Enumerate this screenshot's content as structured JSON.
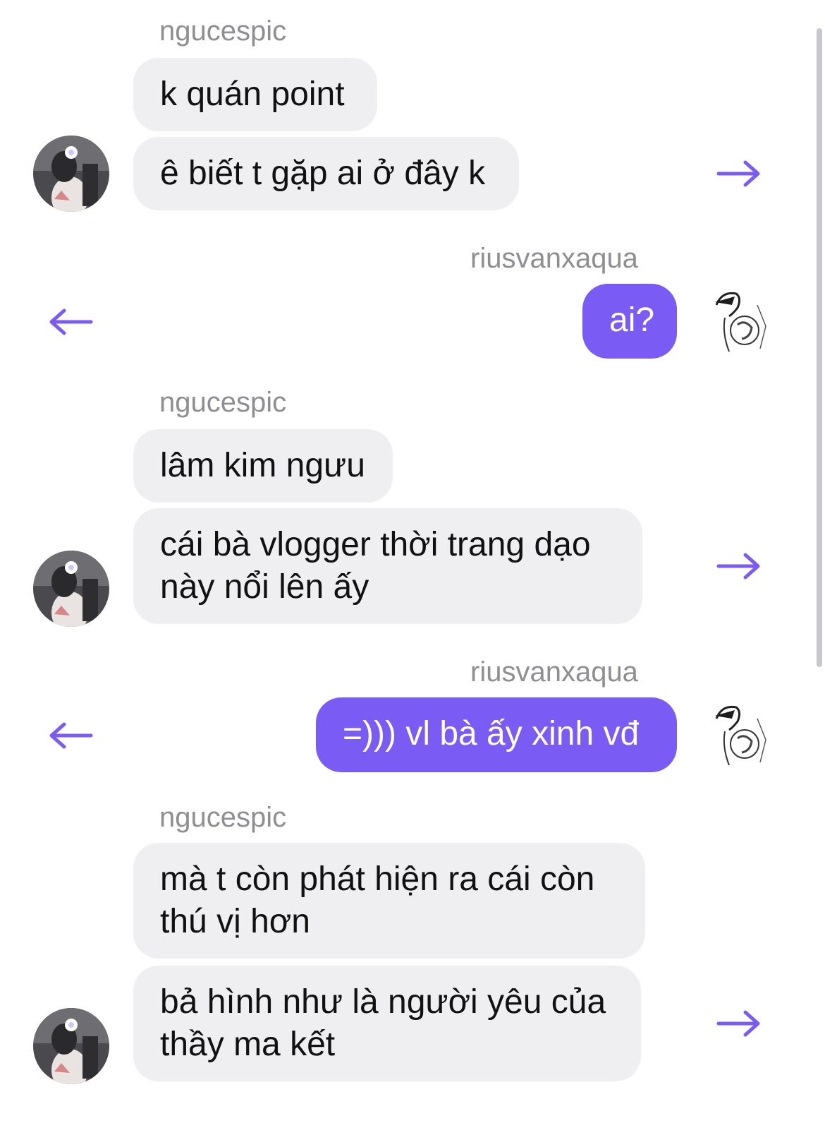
{
  "colors": {
    "accent": "#7a5cf5",
    "incoming_bubble": "#efeff1",
    "username": "#8e8e93"
  },
  "icons": {
    "forward": "arrow-right-icon",
    "reply": "arrow-left-icon"
  },
  "messages": [
    {
      "sender": "ngucespic",
      "text": "k quán point"
    },
    {
      "text": "ê biết t gặp ai ở đây k"
    },
    {
      "sender": "riusvanxaqua",
      "text": "ai?"
    },
    {
      "sender": "ngucespic",
      "text": "lâm kim ngưu"
    },
    {
      "text": "cái bà vlogger thời trang dạo\nnày nổi lên ấy"
    },
    {
      "sender": "riusvanxaqua",
      "text": "=))) vl bà ấy xinh vđ"
    },
    {
      "sender": "ngucespic",
      "text": "mà t còn phát hiện ra cái còn\nthú vị hơn"
    },
    {
      "text": "bả hình như là người yêu của\nthầy ma kết"
    }
  ]
}
